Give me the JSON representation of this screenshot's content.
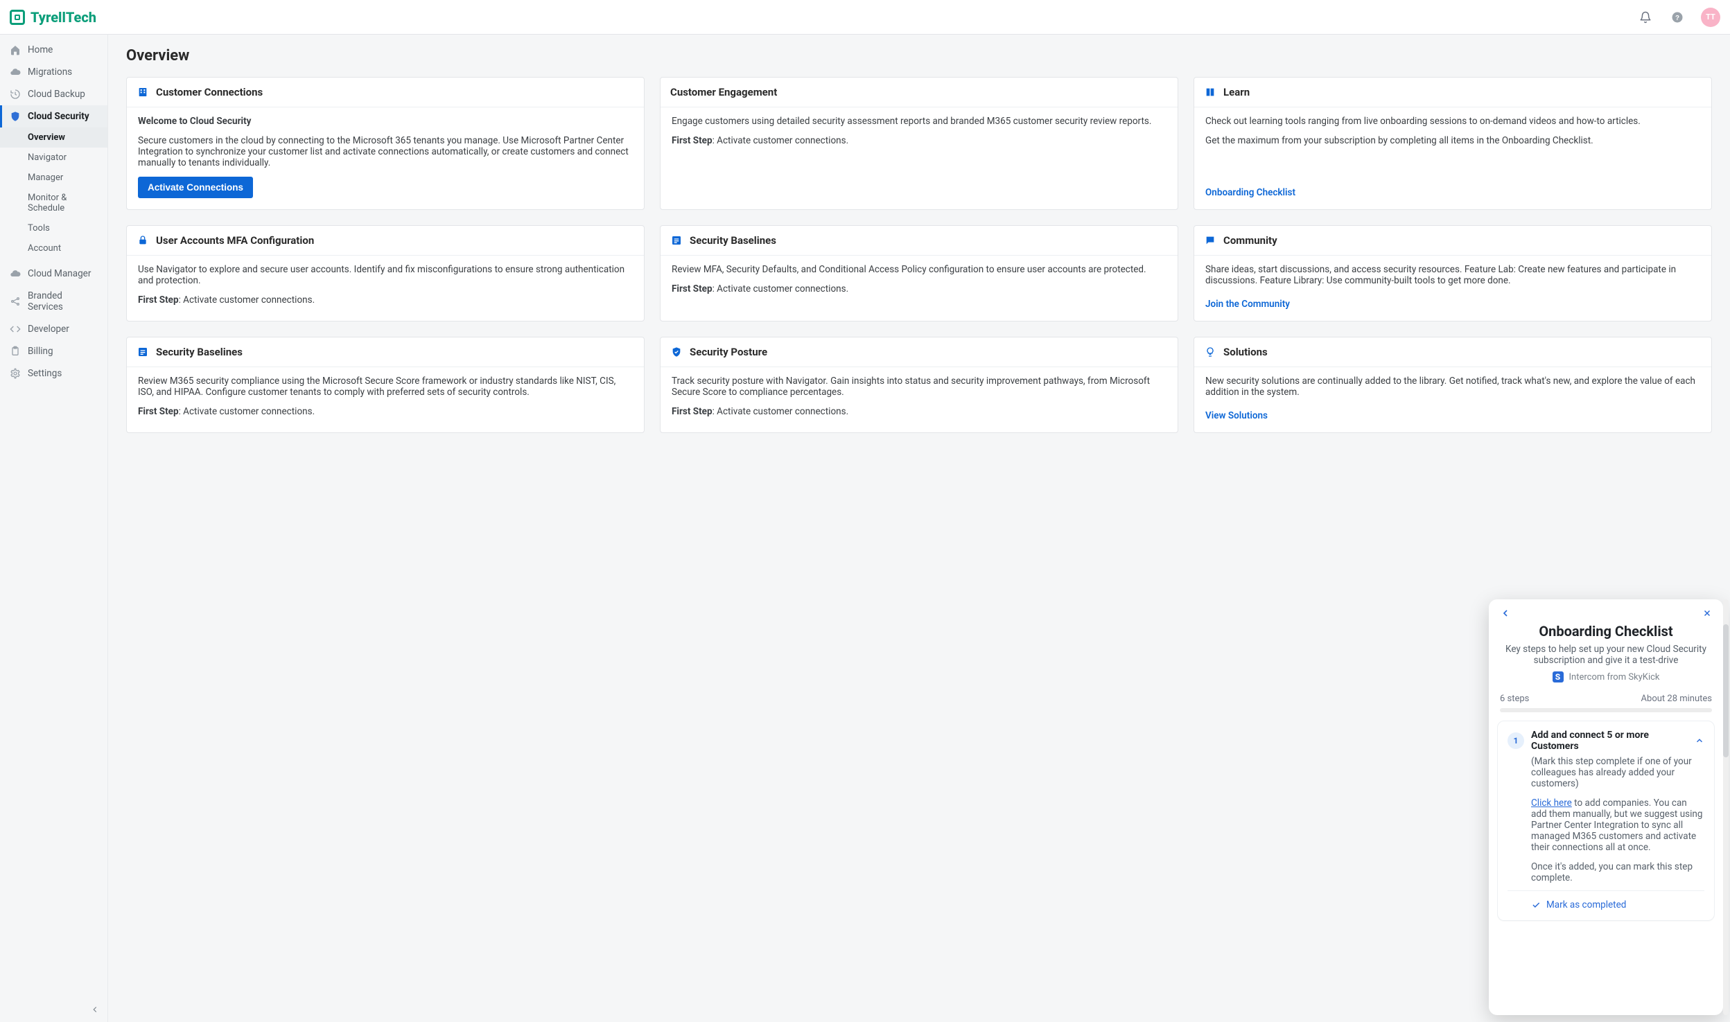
{
  "brand": {
    "name": "TyrellTech"
  },
  "avatar": {
    "initials": "TT"
  },
  "page": {
    "title": "Overview"
  },
  "sidebar": {
    "items": [
      {
        "name": "home",
        "label": "Home"
      },
      {
        "name": "migrations",
        "label": "Migrations"
      },
      {
        "name": "cloud-backup",
        "label": "Cloud Backup"
      },
      {
        "name": "cloud-security",
        "label": "Cloud Security",
        "active": true
      },
      {
        "name": "cloud-manager",
        "label": "Cloud Manager"
      },
      {
        "name": "branded-services",
        "label": "Branded Services"
      },
      {
        "name": "developer",
        "label": "Developer"
      },
      {
        "name": "billing",
        "label": "Billing"
      },
      {
        "name": "settings",
        "label": "Settings"
      }
    ],
    "sub": [
      {
        "name": "overview",
        "label": "Overview",
        "active": true
      },
      {
        "name": "navigator",
        "label": "Navigator"
      },
      {
        "name": "manager",
        "label": "Manager"
      },
      {
        "name": "monitor-schedule",
        "label": "Monitor & Schedule"
      },
      {
        "name": "tools",
        "label": "Tools"
      },
      {
        "name": "account",
        "label": "Account"
      }
    ]
  },
  "cards": {
    "cust_conn": {
      "title": "Customer Connections",
      "subtitle": "Welcome to Cloud Security",
      "body": "Secure customers in the cloud by connecting to the Microsoft 365 tenants you manage. Use Microsoft Partner Center Integration to synchronize your customer list and activate connections automatically, or create customers and connect manually to tenants individually.",
      "cta": "Activate Connections"
    },
    "engagement": {
      "title": "Customer Engagement",
      "body": "Engage customers using detailed security assessment reports and branded M365 customer security review reports.",
      "first_step_label": "First Step",
      "first_step_text": ": Activate customer connections."
    },
    "learn": {
      "title": "Learn",
      "body1": "Check out learning tools ranging from live onboarding sessions to on-demand videos and how-to articles.",
      "body2": "Get the maximum from your subscription by completing all items in the Onboarding Checklist.",
      "link": "Onboarding Checklist"
    },
    "mfa": {
      "title": "User Accounts MFA Configuration",
      "body": "Use Navigator to explore and secure user accounts. Identify and fix misconfigurations to ensure strong authentication and protection.",
      "first_step_label": "First Step",
      "first_step_text": ": Activate customer connections."
    },
    "baselines1": {
      "title": "Security Baselines",
      "body": "Review MFA, Security Defaults, and Conditional Access Policy configuration to ensure user accounts are protected.",
      "first_step_label": "First Step",
      "first_step_text": ": Activate customer connections."
    },
    "community": {
      "title": "Community",
      "body": "Share ideas, start discussions, and access security resources. Feature Lab: Create new features and participate in discussions. Feature Library: Use community-built tools to get more done.",
      "link": "Join the Community"
    },
    "baselines2": {
      "title": "Security Baselines",
      "body": "Review M365 security compliance using the Microsoft Secure Score framework or industry standards like NIST, CIS, ISO, and HIPAA. Configure customer tenants to comply with preferred sets of security controls.",
      "first_step_label": "First Step",
      "first_step_text": ": Activate customer connections."
    },
    "posture": {
      "title": "Security Posture",
      "body": "Track security posture with Navigator. Gain insights into status and security improvement pathways, from Microsoft Secure Score to compliance percentages.",
      "first_step_label": "First Step",
      "first_step_text": ": Activate customer connections."
    },
    "solutions": {
      "title": "Solutions",
      "body": "New security solutions are continually added to the library. Get notified, track what's new, and explore the value of each addition in the system.",
      "link": "View Solutions"
    }
  },
  "popover": {
    "title": "Onboarding Checklist",
    "subtitle": "Key steps to help set up your new Cloud Security subscription and give it a test-drive",
    "from": "Intercom from SkyKick",
    "steps_text": "6 steps",
    "eta_text": "About 28 minutes",
    "step": {
      "num": "1",
      "title": "Add and connect 5 or more Customers",
      "note": "(Mark this step complete if one of your colleagues has already added your customers)",
      "link_text": "Click here",
      "para1_rest": " to add companies. You can add them manually, but we suggest using Partner Center Integration to sync all managed M365 customers and activate their connections all at once.",
      "para2": "Once it's added, you can mark this step complete.",
      "mark": "Mark as completed"
    }
  }
}
